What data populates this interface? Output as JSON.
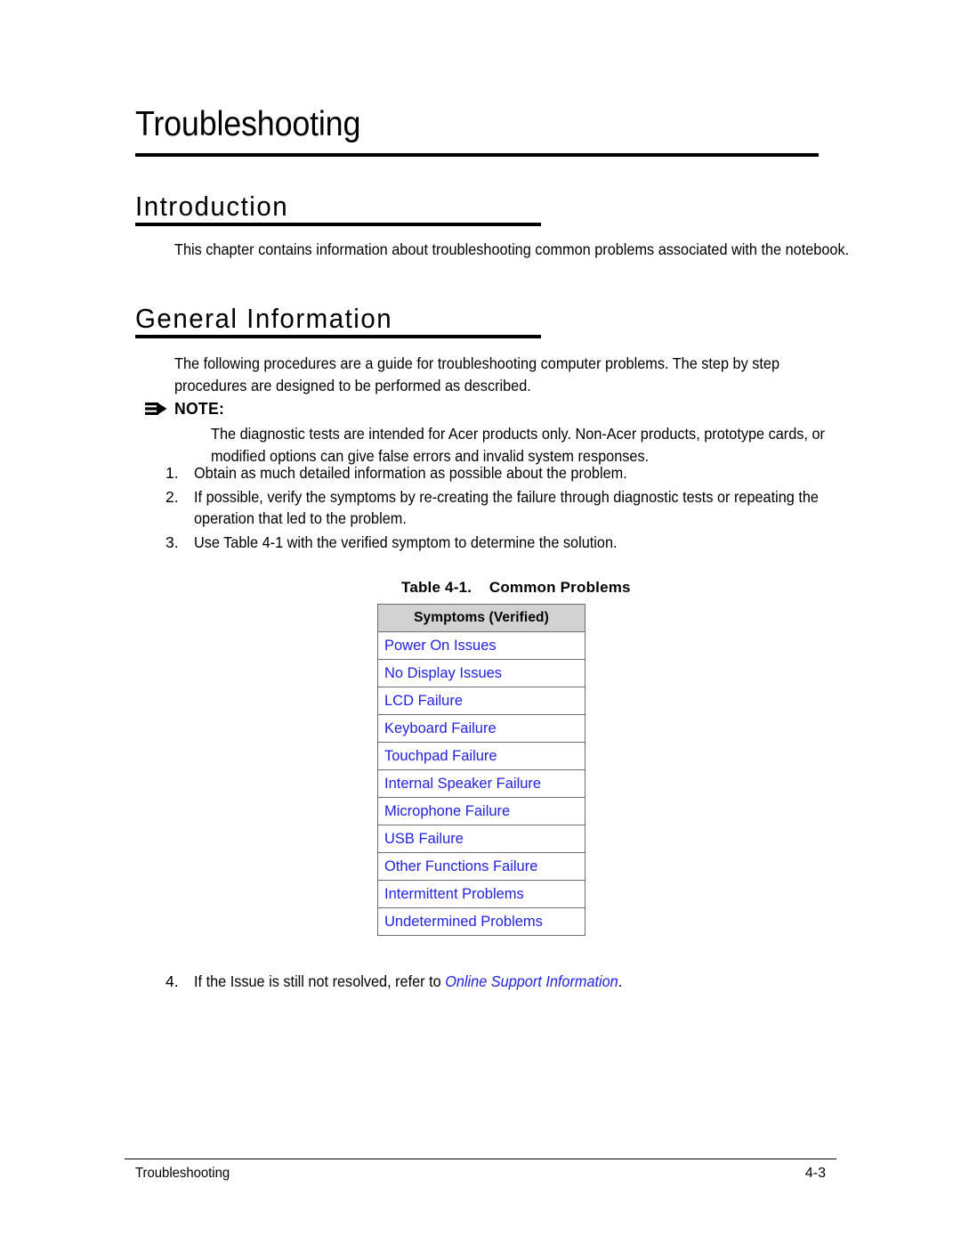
{
  "chapter": {
    "title": "Troubleshooting"
  },
  "sections": {
    "introduction": {
      "heading": "Introduction",
      "paragraph": "This chapter contains information about troubleshooting common problems associated with the notebook."
    },
    "general_information": {
      "heading": "General Information",
      "paragraph": "The following procedures are a guide for troubleshooting computer problems. The step by step procedures are designed to be performed as described."
    }
  },
  "note": {
    "icon": "note-arrow-icon",
    "label": "NOTE:",
    "text": "The diagnostic tests are intended for Acer products only. Non-Acer products, prototype cards, or modified options can give false errors and invalid system responses."
  },
  "steps": [
    {
      "number": "1.",
      "text": "Obtain as much detailed information as possible about the problem."
    },
    {
      "number": "2.",
      "text": "If possible, verify the symptoms by re-creating the failure through diagnostic tests or repeating the operation that led to the problem."
    },
    {
      "number": "3.",
      "text": "Use Table 4-1 with the verified symptom to determine the solution."
    }
  ],
  "step_four": {
    "number": "4.",
    "text_before": "If the Issue is still not resolved, refer to ",
    "link_text": "Online Support Information",
    "text_after": "."
  },
  "table": {
    "caption": "Table 4-1.    Common Problems",
    "header": "Symptoms (Verified)",
    "rows": [
      {
        "label": "Power On Issues"
      },
      {
        "label": "No Display Issues"
      },
      {
        "label": "LCD Failure"
      },
      {
        "label": "Keyboard Failure"
      },
      {
        "label": "Touchpad Failure"
      },
      {
        "label": "Internal Speaker Failure"
      },
      {
        "label": "Microphone Failure"
      },
      {
        "label": "USB Failure"
      },
      {
        "label": "Other Functions Failure"
      },
      {
        "label": "Intermittent Problems"
      },
      {
        "label": "Undetermined Problems"
      }
    ]
  },
  "footer": {
    "left": "Troubleshooting",
    "page_number": "4-3"
  },
  "colors": {
    "link_blue": "#2222dd",
    "table_header_gray": "#d2d2d2",
    "table_border": "#6b6b6b",
    "text_black": "#000000",
    "page_background": "#ffffff"
  }
}
